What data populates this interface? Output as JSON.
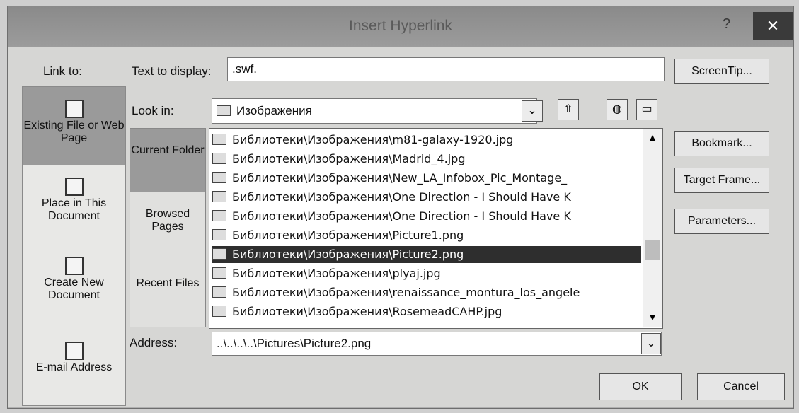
{
  "window": {
    "title": "Insert Hyperlink",
    "help": "?",
    "close": "✕"
  },
  "link_to": {
    "label": "Link to:",
    "items": [
      {
        "label": "Existing File or Web Page"
      },
      {
        "label": "Place in This Document"
      },
      {
        "label": "Create New Document"
      },
      {
        "label": "E-mail Address"
      }
    ]
  },
  "text_display": {
    "label": "Text to display:",
    "value": ".swf."
  },
  "screentip_btn": "ScreenTip...",
  "look_in": {
    "label": "Look in:",
    "value": "Изображения"
  },
  "side": {
    "current": "Current Folder",
    "browsed": "Browsed Pages",
    "recent": "Recent Files"
  },
  "files": [
    "Библиотеки\\Изображения\\m81-galaxy-1920.jpg",
    "Библиотеки\\Изображения\\Madrid_4.jpg",
    "Библиотеки\\Изображения\\New_LA_Infobox_Pic_Montage_",
    "Библиотеки\\Изображения\\One Direction - I Should Have K",
    "Библиотеки\\Изображения\\One Direction - I Should Have K",
    "Библиотеки\\Изображения\\Picture1.png",
    "Библиотеки\\Изображения\\Picture2.png",
    "Библиотеки\\Изображения\\plyaj.jpg",
    "Библиотеки\\Изображения\\renaissance_montura_los_angele",
    "Библиотеки\\Изображения\\RosemeadCAHP.jpg"
  ],
  "buttons": {
    "bookmark": "Bookmark...",
    "target": "Target Frame...",
    "params": "Parameters...",
    "ok": "OK",
    "cancel": "Cancel"
  },
  "address": {
    "label": "Address:",
    "value": "..\\..\\..\\..\\Pictures\\Picture2.png"
  }
}
